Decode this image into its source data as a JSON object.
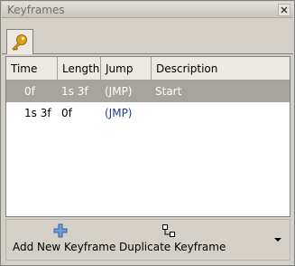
{
  "window": {
    "title": "Keyframes"
  },
  "tabs": [
    {
      "icon": "key-icon"
    }
  ],
  "table": {
    "columns": [
      "Time",
      "Length",
      "Jump",
      "Description"
    ],
    "rows": [
      {
        "time": "0f",
        "length": "1s 3f",
        "jump": "(JMP)",
        "description": "Start",
        "selected": true
      },
      {
        "time": "1s 3f",
        "length": "0f",
        "jump": "(JMP)",
        "description": "",
        "selected": false
      }
    ]
  },
  "toolbar": {
    "add_label": "Add New Keyframe",
    "duplicate_label": "Duplicate Keyframe"
  },
  "colors": {
    "selection": "#a7a49e",
    "jump_link": "#1a3d8a"
  }
}
